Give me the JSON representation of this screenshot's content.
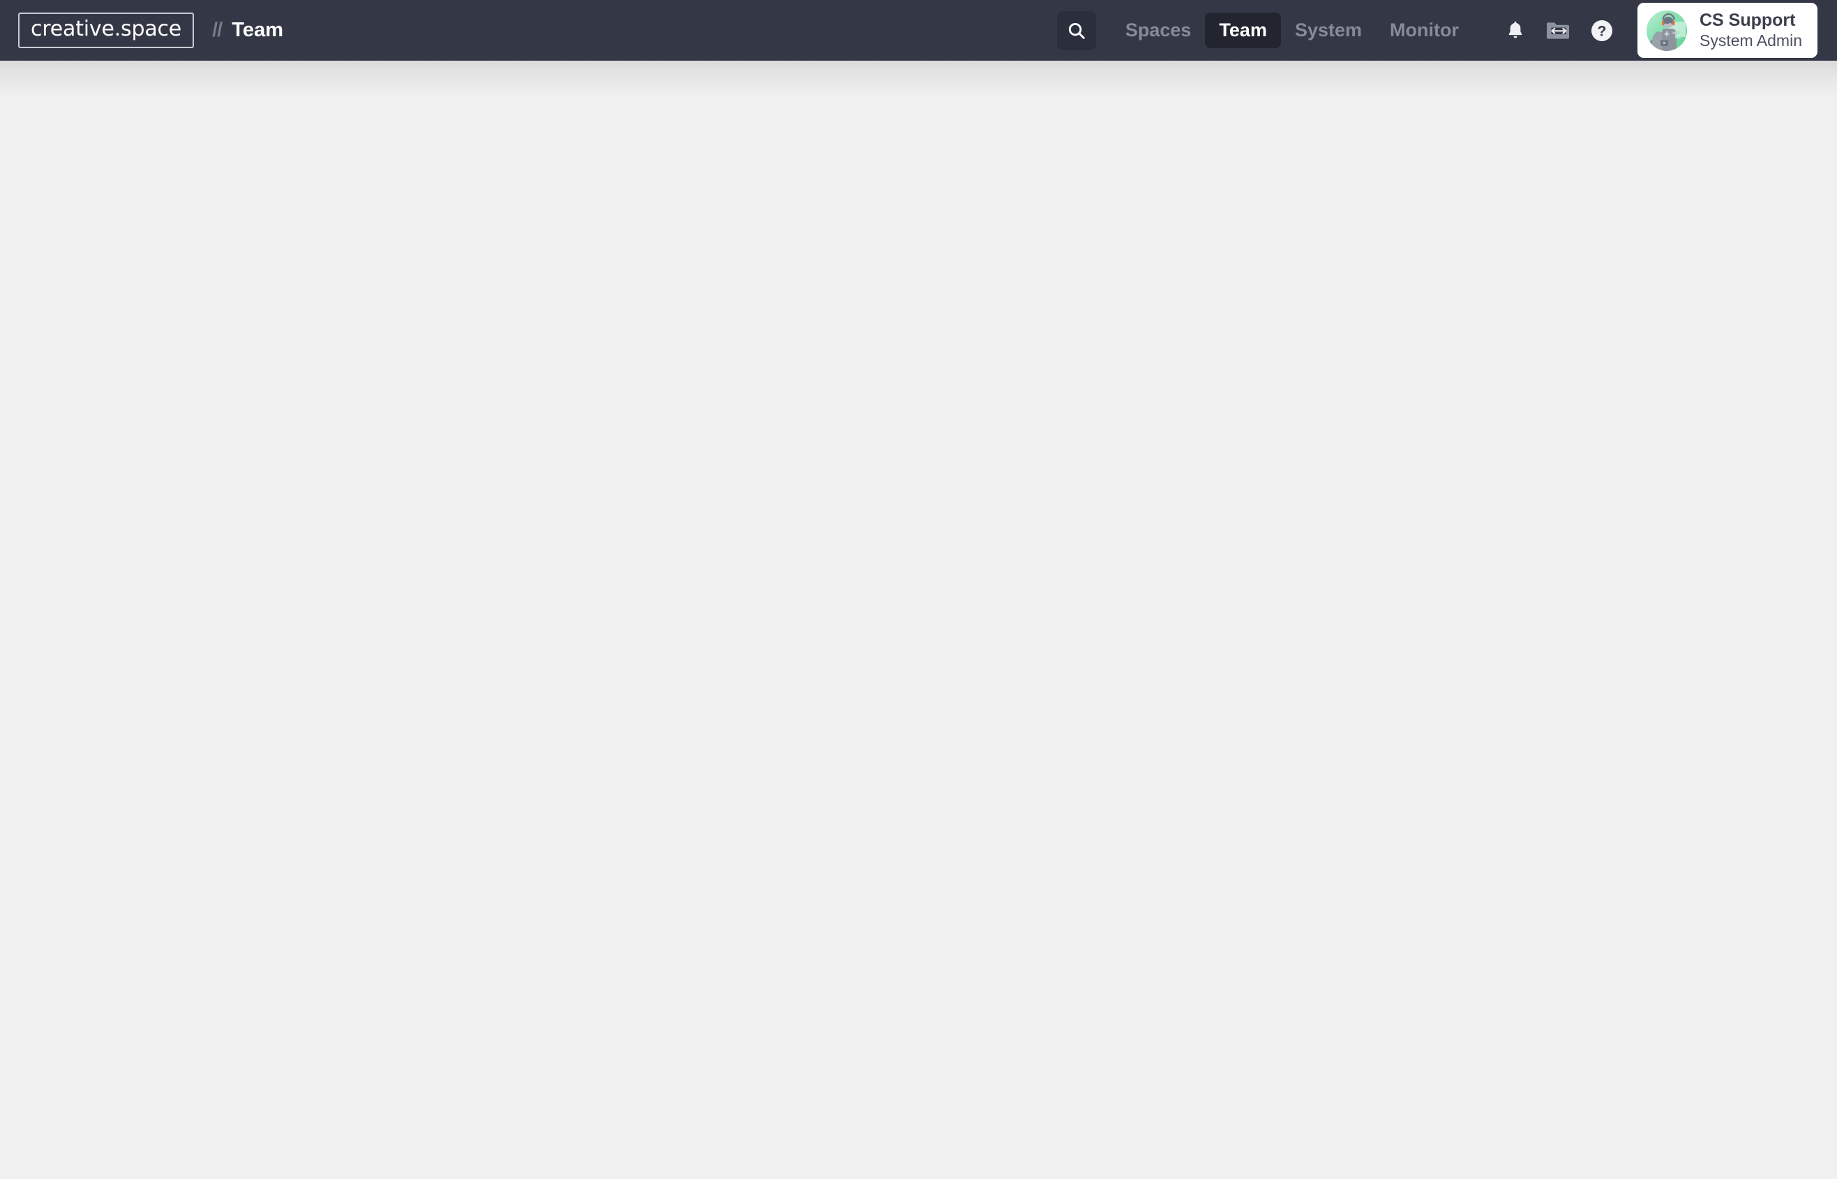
{
  "app": {
    "logo_text": "creative.space",
    "breadcrumb_separator": "//",
    "page_title": "Team",
    "header_bg": "#343846",
    "body_bg": "#f0f0f0",
    "active_pill_bg": "#22252f",
    "inactive_nav_color": "#868b99",
    "accent_avatar_green": "#74d6a4"
  },
  "search": {
    "icon": "search-icon",
    "label": "Search"
  },
  "nav": {
    "items": [
      {
        "label": "Spaces",
        "active": false
      },
      {
        "label": "Team",
        "active": true
      },
      {
        "label": "System",
        "active": false
      },
      {
        "label": "Monitor",
        "active": false
      }
    ]
  },
  "icons": [
    {
      "name": "bell-icon",
      "label": "Notifications"
    },
    {
      "name": "folder-transfer-icon",
      "label": "File Transfer"
    },
    {
      "name": "help-circle-icon",
      "label": "Help"
    }
  ],
  "user": {
    "name": "CS Support",
    "role": "System Admin",
    "avatar": "support-agent-avatar"
  },
  "main": {
    "content": ""
  }
}
